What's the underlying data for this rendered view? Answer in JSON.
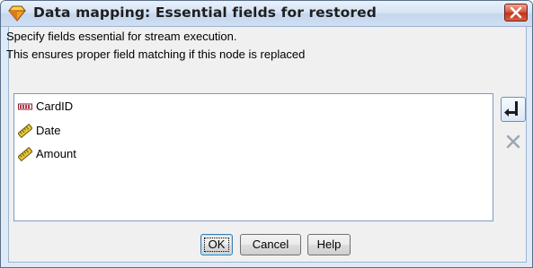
{
  "window": {
    "title": "Data mapping: Essential fields for restored"
  },
  "description": {
    "line1": "Specify fields essential for stream execution.",
    "line2": "This ensures proper field matching if this node is replaced"
  },
  "fields": [
    {
      "label": "CardID",
      "icon": "nominal-type-icon",
      "color": "#c0304a"
    },
    {
      "label": "Date",
      "icon": "continuous-ruler-icon",
      "color": "#e6c63a"
    },
    {
      "label": "Amount",
      "icon": "continuous-ruler-icon",
      "color": "#e6c63a"
    }
  ],
  "side_buttons": {
    "add": "add-field-icon",
    "remove": "remove-field-icon"
  },
  "buttons": {
    "ok_label": "OK",
    "cancel_label": "Cancel",
    "help_label": "Help"
  },
  "colors": {
    "title_bar": "#d6e4f5",
    "close_button": "#d9553e",
    "dialog_bg": "#f0f0f0",
    "list_border": "#7a9bcc"
  }
}
